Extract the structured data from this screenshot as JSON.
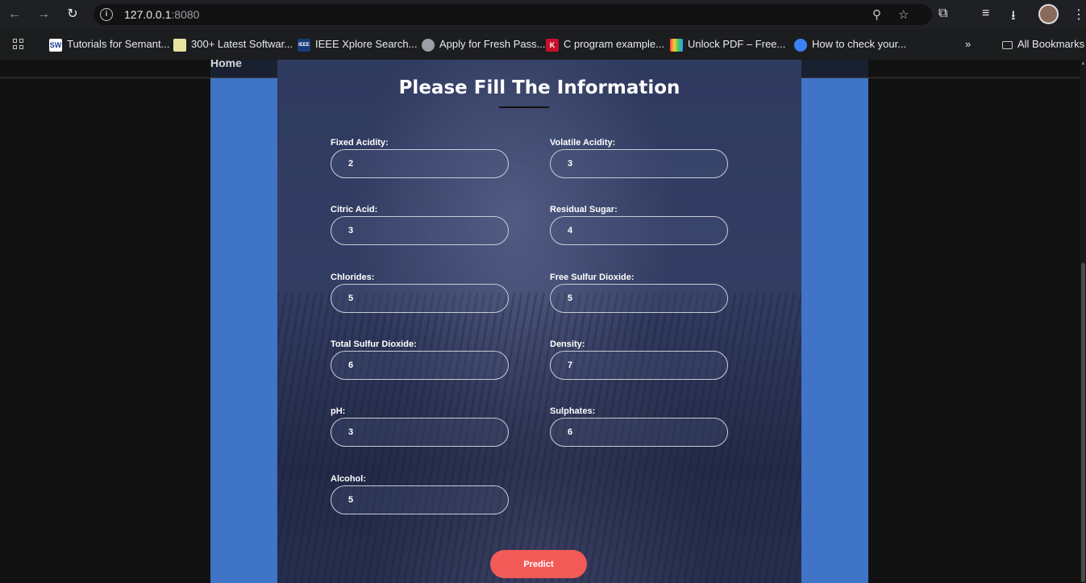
{
  "browser": {
    "url_host": "127.0.0.1",
    "url_port": ":8080",
    "bookmarks": [
      {
        "label": "Tutorials for Semant...",
        "icon": "SW"
      },
      {
        "label": "300+ Latest Softwar...",
        "icon": "software-icon"
      },
      {
        "label": "IEEE Xplore Search...",
        "icon": "IEEE"
      },
      {
        "label": "Apply for Fresh Pass...",
        "icon": "globe-icon"
      },
      {
        "label": "C program example...",
        "icon": "K"
      },
      {
        "label": "Unlock PDF – Free...",
        "icon": "pdf-icon"
      },
      {
        "label": "How to check your...",
        "icon": "site-icon"
      }
    ],
    "more_bookmarks": "»",
    "all_bookmarks": "All Bookmarks"
  },
  "page": {
    "nav_home": "Home",
    "title": "Please Fill The Information",
    "fields": {
      "fixed_acidity": {
        "label": "Fixed Acidity:",
        "value": "2"
      },
      "volatile_acidity": {
        "label": "Volatile Acidity:",
        "value": "3"
      },
      "citric_acid": {
        "label": "Citric Acid:",
        "value": "3"
      },
      "residual_sugar": {
        "label": "Residual Sugar:",
        "value": "4"
      },
      "chlorides": {
        "label": "Chlorides:",
        "value": "5"
      },
      "free_sulfur_dioxide": {
        "label": "Free Sulfur Dioxide:",
        "value": "5"
      },
      "total_sulfur_dioxide": {
        "label": "Total Sulfur Dioxide:",
        "value": "6"
      },
      "density": {
        "label": "Density:",
        "value": "7"
      },
      "ph": {
        "label": "pH:",
        "value": "3"
      },
      "sulphates": {
        "label": "Sulphates:",
        "value": "6"
      },
      "alcohol": {
        "label": "Alcohol:",
        "value": "5"
      }
    },
    "predict_label": "Predict"
  },
  "colors": {
    "side_panel": "#3f74c6",
    "predict_button": "#f25a58"
  }
}
